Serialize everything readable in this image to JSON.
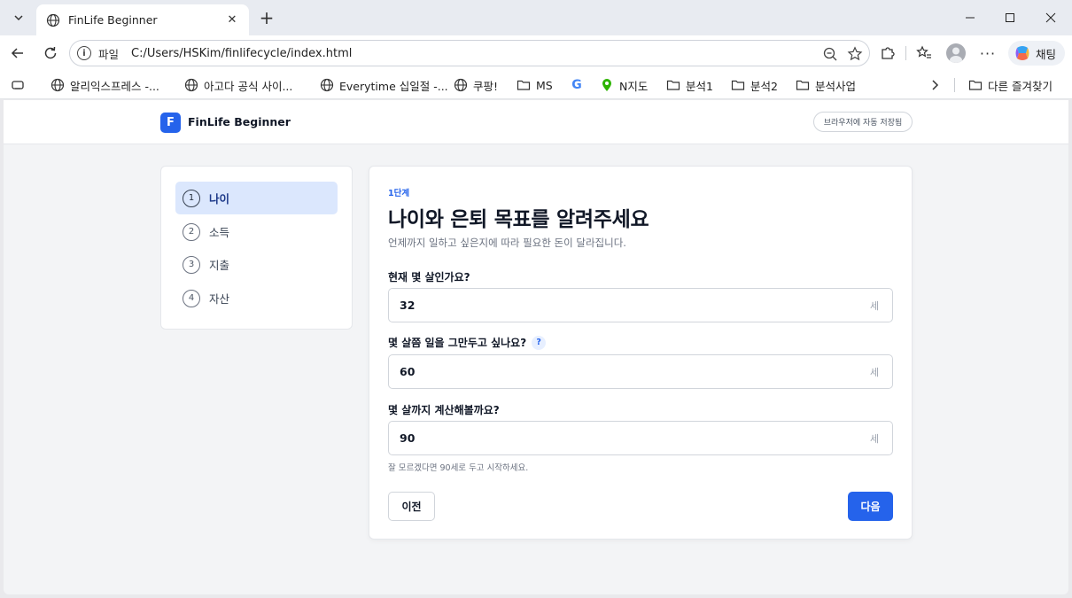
{
  "browser": {
    "tab_title": "FinLife Beginner",
    "address_scheme": "파일",
    "address_url": "C:/Users/HSKim/finlifecycle/index.html",
    "chat_label": "채팅",
    "bookmarks": [
      {
        "label": "알리익스프레스 -...",
        "icon": "globe-icon"
      },
      {
        "label": "아고다 공식 사이...",
        "icon": "globe-icon"
      },
      {
        "label": "Everytime 십일절 -...",
        "icon": "globe-icon"
      },
      {
        "label": "쿠팡!",
        "icon": "globe-icon"
      },
      {
        "label": "MS",
        "icon": "folder-icon"
      },
      {
        "label": "",
        "icon": "google-icon"
      },
      {
        "label": "N지도",
        "icon": "map-pin-icon"
      },
      {
        "label": "분석1",
        "icon": "folder-icon"
      },
      {
        "label": "분석2",
        "icon": "folder-icon"
      },
      {
        "label": "분석사업",
        "icon": "folder-icon"
      }
    ],
    "other_favorites": "다른 즐겨찾기"
  },
  "app": {
    "logo_letter": "F",
    "brand": "FinLife Beginner",
    "autosave_badge": "브라우저에 자동 저장됨"
  },
  "steps": [
    {
      "num": "1",
      "label": "나이",
      "active": true
    },
    {
      "num": "2",
      "label": "소득",
      "active": false
    },
    {
      "num": "3",
      "label": "지출",
      "active": false
    },
    {
      "num": "4",
      "label": "자산",
      "active": false
    }
  ],
  "form": {
    "eyebrow": "1단계",
    "heading": "나이와 은퇴 목표를 알려주세요",
    "subtitle": "언제까지 일하고 싶은지에 따라 필요한 돈이 달라집니다.",
    "questions": [
      {
        "label": "현재 몇 살인가요?",
        "value": "32",
        "unit": "세"
      },
      {
        "label": "몇 살쯤 일을 그만두고 싶나요?",
        "value": "60",
        "unit": "세",
        "help": "?"
      },
      {
        "label": "몇 살까지 계산해볼까요?",
        "value": "90",
        "unit": "세"
      }
    ],
    "hint": "잘 모르겠다면 90세로 두고 시작하세요.",
    "prev_label": "이전",
    "next_label": "다음"
  },
  "colors": {
    "accent": "#2563eb",
    "active_step_bg": "#dbe7fd"
  }
}
